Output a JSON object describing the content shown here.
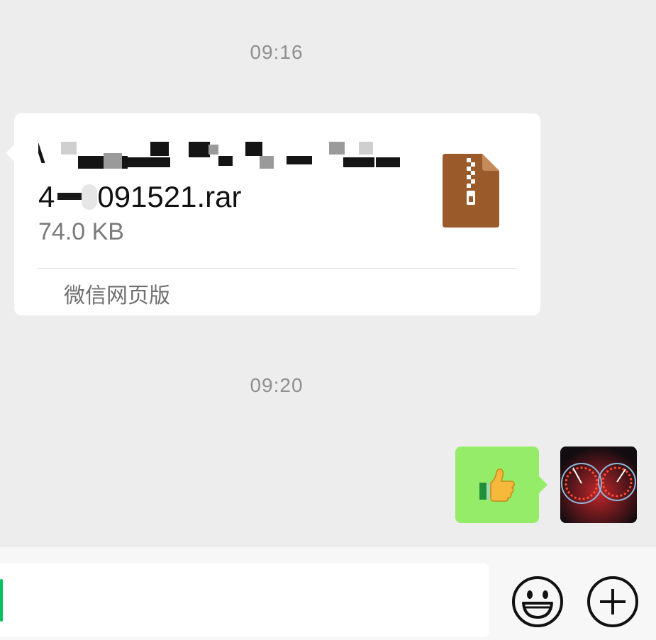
{
  "chat": {
    "timestamps": [
      "09:16",
      "09:20"
    ],
    "file_message": {
      "file_name_visible_suffix": "091521.rar",
      "file_name_visible_prefix": "4",
      "file_size": "74.0 KB",
      "file_icon": "rar-archive-icon",
      "source_label": "微信网页版"
    },
    "outgoing_message": {
      "content": "thumbs-up-emoji",
      "bubble_color": "#95ec69"
    },
    "avatar": "speedometer-dashboard-avatar"
  },
  "input_bar": {
    "value": "",
    "caret_color": "#07c160",
    "icons": [
      "emoji-icon",
      "plus-icon"
    ]
  },
  "colors": {
    "background": "#ededed",
    "rar_icon": "#9b5a2a"
  }
}
